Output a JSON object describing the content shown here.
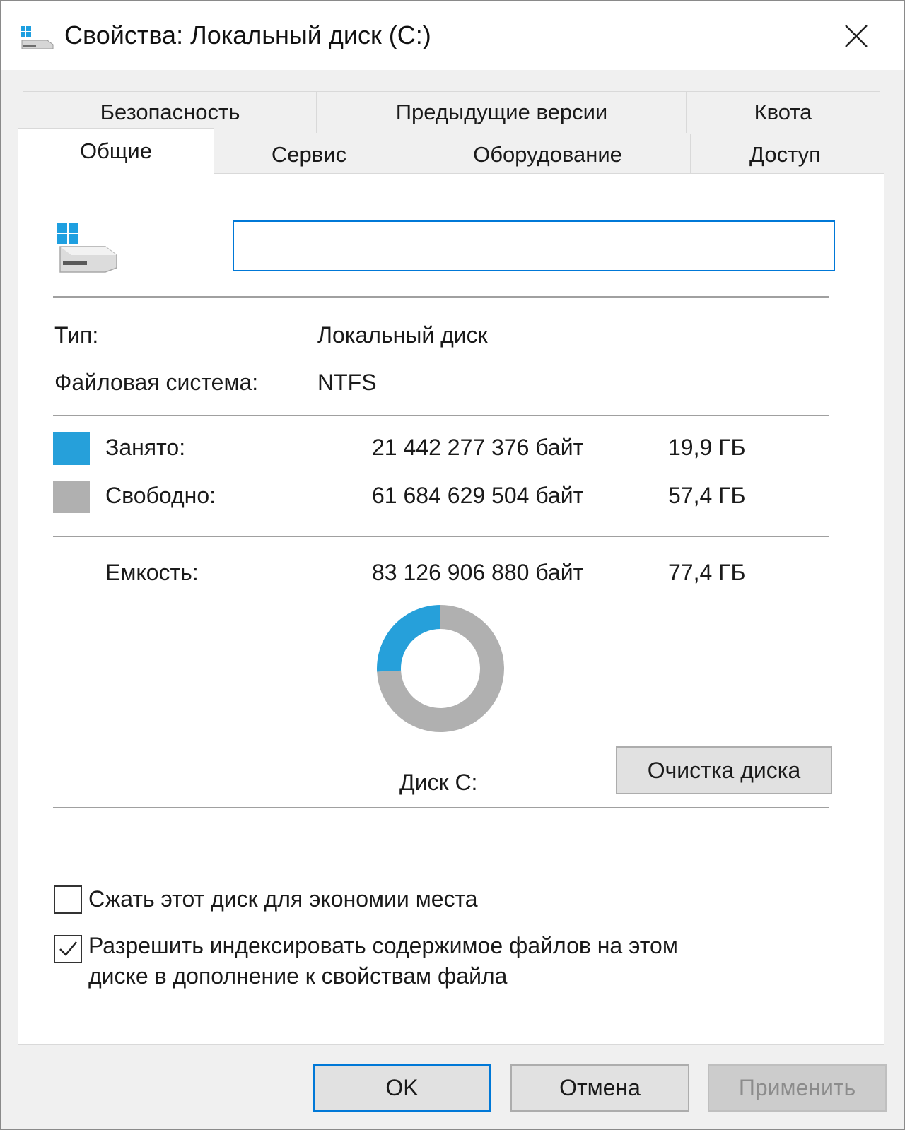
{
  "window": {
    "title": "Свойства: Локальный диск (C:)",
    "close_icon": "close-icon"
  },
  "tabs": {
    "row1": [
      "Безопасность",
      "Предыдущие версии",
      "Квота"
    ],
    "row2": [
      "Общие",
      "Сервис",
      "Оборудование",
      "Доступ"
    ],
    "active": "Общие"
  },
  "general": {
    "drive_icon": "windows-drive-icon",
    "name_value": "",
    "type_label": "Тип:",
    "type_value": "Локальный диск",
    "fs_label": "Файловая система:",
    "fs_value": "NTFS",
    "used_label": "Занято:",
    "used_bytes": "21 442 277 376 байт",
    "used_size": "19,9 ГБ",
    "free_label": "Свободно:",
    "free_bytes": "61 684 629 504 байт",
    "free_size": "57,4 ГБ",
    "capacity_label": "Емкость:",
    "capacity_bytes": "83 126 906 880 байт",
    "capacity_size": "77,4 ГБ",
    "used_fraction": 0.258,
    "disk_label": "Диск C:",
    "cleanup_button": "Очистка диска",
    "compress_label": "Сжать этот диск для экономии места",
    "compress_checked": false,
    "index_label_line1": "Разрешить индексировать содержимое файлов на этом",
    "index_label_line2": "диске в дополнение к свойствам файла",
    "index_checked": true
  },
  "colors": {
    "used": "#26a0da",
    "free": "#b0b0b0"
  },
  "footer": {
    "ok": "OK",
    "cancel": "Отмена",
    "apply": "Применить"
  }
}
